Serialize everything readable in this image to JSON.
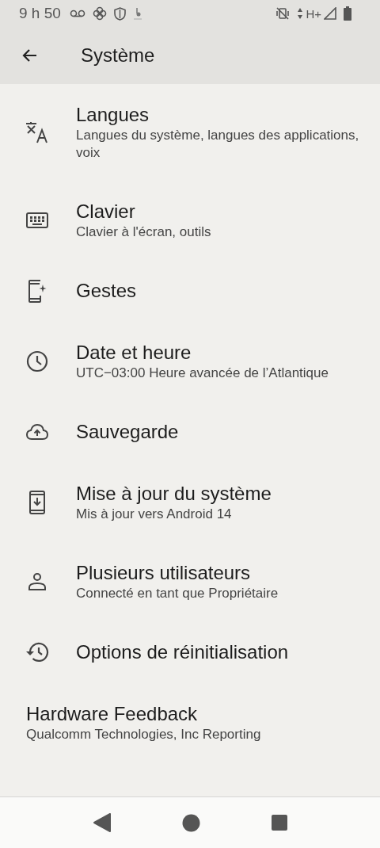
{
  "status_bar": {
    "time": "9 h 50",
    "network": "H+"
  },
  "app_bar": {
    "title": "Système"
  },
  "items": [
    {
      "kind": "icon",
      "title": "Langues",
      "subtitle": "Langues du système, langues des applications, voix"
    },
    {
      "kind": "icon",
      "title": "Clavier",
      "subtitle": "Clavier à l'écran, outils"
    },
    {
      "kind": "icon",
      "title": "Gestes"
    },
    {
      "kind": "icon",
      "title": "Date et heure",
      "subtitle": "UTC−03:00 Heure avancée de l’Atlantique"
    },
    {
      "kind": "icon",
      "title": "Sauvegarde"
    },
    {
      "kind": "icon",
      "title": "Mise à jour du système",
      "subtitle": "Mis à jour vers Android 14"
    },
    {
      "kind": "icon",
      "title": "Plusieurs utilisateurs",
      "subtitle": "Connecté en tant que Propriétaire"
    },
    {
      "kind": "icon",
      "title": "Options de réinitialisation"
    },
    {
      "kind": "plain",
      "title": "Hardware Feedback",
      "subtitle": "Qualcomm Technologies, Inc Reporting"
    }
  ]
}
